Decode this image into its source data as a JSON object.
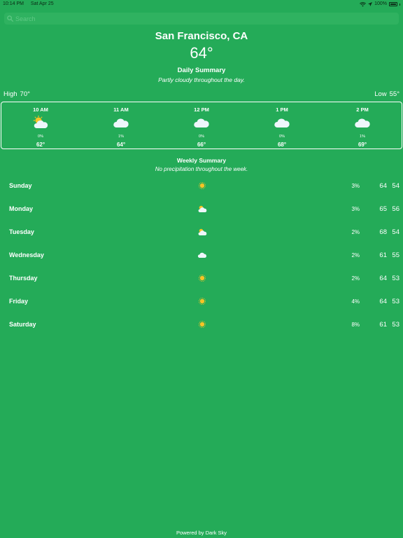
{
  "status_bar": {
    "time": "10:14 PM",
    "date": "Sat Apr 25",
    "battery": "100%"
  },
  "search": {
    "placeholder": "Search"
  },
  "location": {
    "city": "San Francisco, CA",
    "temperature": "64°"
  },
  "daily": {
    "title": "Daily Summary",
    "summary": "Partly cloudy throughout the day."
  },
  "range": {
    "high_label": "High",
    "high_value": "70°",
    "low_label": "Low",
    "low_value": "55°"
  },
  "hourly": [
    {
      "time": "10 AM",
      "icon": "partly-cloudy-icon",
      "precip": "0%",
      "temp": "62°"
    },
    {
      "time": "11 AM",
      "icon": "cloud-icon",
      "precip": "1%",
      "temp": "64°"
    },
    {
      "time": "12 PM",
      "icon": "cloud-icon",
      "precip": "0%",
      "temp": "66°"
    },
    {
      "time": "1 PM",
      "icon": "cloud-icon",
      "precip": "0%",
      "temp": "68°"
    },
    {
      "time": "2 PM",
      "icon": "cloud-icon",
      "precip": "1%",
      "temp": "69°"
    }
  ],
  "weekly": {
    "title": "Weekly Summary",
    "summary": "No precipitation throughout the week.",
    "days": [
      {
        "name": "Sunday",
        "icon": "sun-icon",
        "precip": "3%",
        "high": "64",
        "low": "54"
      },
      {
        "name": "Monday",
        "icon": "partly-cloudy-icon",
        "precip": "3%",
        "high": "65",
        "low": "56"
      },
      {
        "name": "Tuesday",
        "icon": "partly-cloudy-icon",
        "precip": "2%",
        "high": "68",
        "low": "54"
      },
      {
        "name": "Wednesday",
        "icon": "cloud-icon",
        "precip": "2%",
        "high": "61",
        "low": "55"
      },
      {
        "name": "Thursday",
        "icon": "sun-icon",
        "precip": "2%",
        "high": "64",
        "low": "53"
      },
      {
        "name": "Friday",
        "icon": "sun-icon",
        "precip": "4%",
        "high": "64",
        "low": "53"
      },
      {
        "name": "Saturday",
        "icon": "sun-icon",
        "precip": "8%",
        "high": "61",
        "low": "53"
      }
    ]
  },
  "footer": {
    "text": "Powered by Dark Sky"
  },
  "colors": {
    "background": "#24ab58",
    "search_field": "#2fb260",
    "sun": "#f7c325",
    "cloud": "#eef6fb"
  }
}
